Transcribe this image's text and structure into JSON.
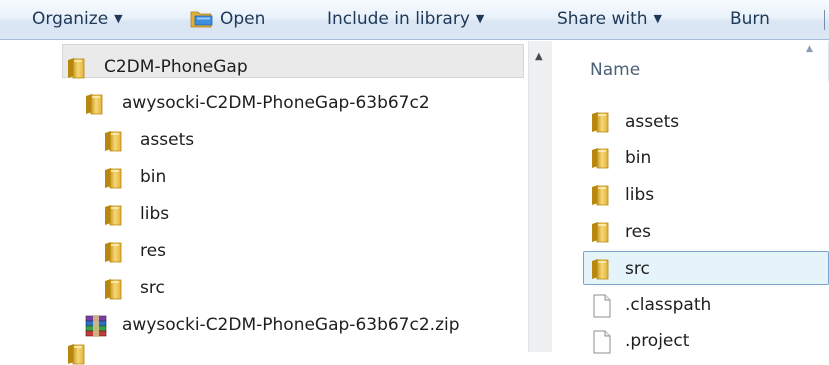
{
  "toolbar": {
    "organize": "Organize",
    "open": "Open",
    "include_in_library": "Include in library",
    "share_with": "Share with",
    "burn": "Burn"
  },
  "navigation": {
    "items": [
      {
        "label": "C2DM-PhoneGap",
        "icon": "folder-icon"
      },
      {
        "label": "awysocki-C2DM-PhoneGap-63b67c2",
        "icon": "folder-icon",
        "selected": true
      },
      {
        "label": "assets",
        "icon": "folder-icon"
      },
      {
        "label": "bin",
        "icon": "folder-icon"
      },
      {
        "label": "libs",
        "icon": "folder-icon"
      },
      {
        "label": "res",
        "icon": "folder-icon"
      },
      {
        "label": "src",
        "icon": "folder-icon"
      },
      {
        "label": "awysocki-C2DM-PhoneGap-63b67c2.zip",
        "icon": "winrar-archive-icon"
      }
    ]
  },
  "file_list": {
    "column_header": "Name",
    "items": [
      {
        "label": "assets",
        "icon": "folder-icon"
      },
      {
        "label": "bin",
        "icon": "folder-icon"
      },
      {
        "label": "libs",
        "icon": "folder-icon"
      },
      {
        "label": "res",
        "icon": "folder-icon"
      },
      {
        "label": "src",
        "icon": "folder-icon",
        "selected": true
      },
      {
        "label": ".classpath",
        "icon": "document-icon"
      },
      {
        "label": ".project",
        "icon": "document-icon"
      }
    ]
  },
  "colors": {
    "toolbar_text": "#1e3957",
    "selection_fill": "#e5f3fb",
    "selection_border": "#7da2ce",
    "folder": "#e8b834"
  }
}
